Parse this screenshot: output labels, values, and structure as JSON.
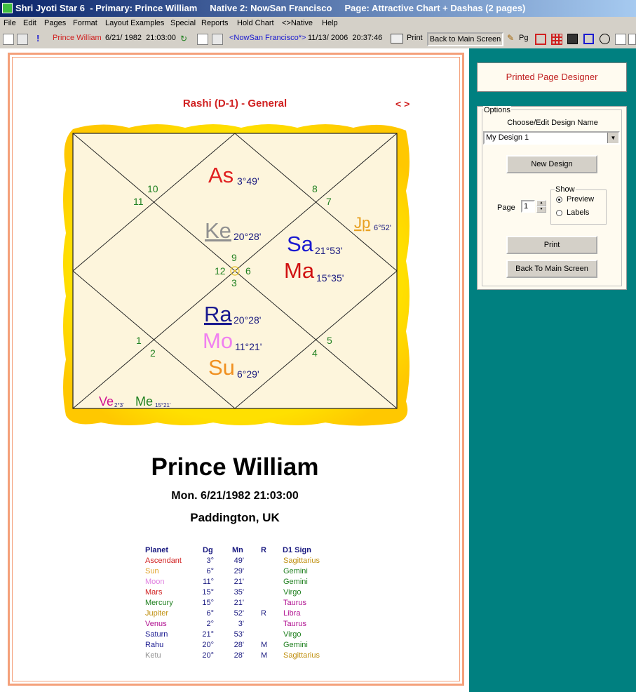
{
  "window": {
    "title": "Shri Jyoti Star 6  - Primary: Prince William     Native 2: NowSan Francisco     Page: Attractive Chart + Dashas (2 pages)"
  },
  "menu": [
    "File",
    "Edit",
    "Pages",
    "Format",
    "Layout Examples",
    "Special",
    "Reports",
    "Hold Chart",
    "<>Native",
    "Help"
  ],
  "toolbar": {
    "primary_name": "Prince William",
    "primary_datetime": "6/21/ 1982  21:03:00",
    "native2_name": "<NowSan Francisco*>",
    "native2_datetime": "11/13/ 2006  20:37:46",
    "print_label": "Print",
    "back_main_label": "Back to Main Screen",
    "pg_label": "Pg"
  },
  "chart": {
    "title": "Rashi (D-1) - General",
    "nav": "< >",
    "houses": {
      "h1": "1",
      "h2": "2",
      "h3": "3",
      "h4": "4",
      "h5": "5",
      "h6": "6",
      "h7": "7",
      "h8": "8",
      "h9": "9",
      "h10": "10",
      "h11": "11",
      "h12": "12"
    },
    "planets": {
      "as": {
        "abbr": "As",
        "deg": "3°49'",
        "color": "#e02020"
      },
      "ke": {
        "abbr": "Ke",
        "deg": "20°28'",
        "color": "#909090"
      },
      "sa": {
        "abbr": "Sa",
        "deg": "21°53'",
        "color": "#1a1ad0"
      },
      "ma": {
        "abbr": "Ma",
        "deg": "15°35'",
        "color": "#d01010"
      },
      "jp": {
        "abbr": "Jp",
        "deg": "6°52'",
        "color": "#e8a020"
      },
      "ra": {
        "abbr": "Ra",
        "deg": "20°28'",
        "color": "#1a1a90"
      },
      "mo": {
        "abbr": "Mo",
        "deg": "11°21'",
        "color": "#f080f0"
      },
      "su": {
        "abbr": "Su",
        "deg": "6°29'",
        "color": "#f09020"
      },
      "ve": {
        "abbr": "Ve",
        "deg": "2°3'",
        "color": "#d01090"
      },
      "me": {
        "abbr": "Me",
        "deg": "15°21'",
        "color": "#208020"
      }
    }
  },
  "person": {
    "name": "Prince William",
    "datetime": "Mon. 6/21/1982  21:03:00",
    "place": "Paddington, UK"
  },
  "table": {
    "headers": [
      "Planet",
      "Dg",
      "Mn",
      "R",
      "D1 Sign"
    ],
    "rows": [
      {
        "planet": "Ascendant",
        "dg": "3°",
        "mn": "49'",
        "r": "",
        "sign": "Sagittarius",
        "pcolor": "#d02020",
        "scolor": "#c09010"
      },
      {
        "planet": "Sun",
        "dg": "6°",
        "mn": "29'",
        "r": "",
        "sign": "Gemini",
        "pcolor": "#e0a020",
        "scolor": "#208020"
      },
      {
        "planet": "Moon",
        "dg": "11°",
        "mn": "21'",
        "r": "",
        "sign": "Gemini",
        "pcolor": "#e080e0",
        "scolor": "#208020"
      },
      {
        "planet": "Mars",
        "dg": "15°",
        "mn": "35'",
        "r": "",
        "sign": "Virgo",
        "pcolor": "#d02020",
        "scolor": "#208020"
      },
      {
        "planet": "Mercury",
        "dg": "15°",
        "mn": "21'",
        "r": "",
        "sign": "Taurus",
        "pcolor": "#208020",
        "scolor": "#b01090"
      },
      {
        "planet": "Jupiter",
        "dg": "6°",
        "mn": "52'",
        "r": "R",
        "sign": "Libra",
        "pcolor": "#c09010",
        "scolor": "#b01090"
      },
      {
        "planet": "Venus",
        "dg": "2°",
        "mn": "3'",
        "r": "",
        "sign": "Taurus",
        "pcolor": "#b01090",
        "scolor": "#b01090"
      },
      {
        "planet": "Saturn",
        "dg": "21°",
        "mn": "53'",
        "r": "",
        "sign": "Virgo",
        "pcolor": "#1a1a90",
        "scolor": "#208020"
      },
      {
        "planet": "Rahu",
        "dg": "20°",
        "mn": "28'",
        "r": "M",
        "sign": "Gemini",
        "pcolor": "#1a1a90",
        "scolor": "#208020"
      },
      {
        "planet": "Ketu",
        "dg": "20°",
        "mn": "28'",
        "r": "M",
        "sign": "Sagittarius",
        "pcolor": "#909090",
        "scolor": "#c09010"
      }
    ]
  },
  "designer": {
    "title": "Printed Page Designer",
    "options_label": "Options",
    "choose_label": "Choose/Edit Design Name",
    "design_value": "My Design 1",
    "new_design_label": "New Design",
    "page_label": "Page",
    "page_value": "1",
    "show_label": "Show",
    "preview_label": "Preview",
    "labels_label": "Labels",
    "print_label": "Print",
    "back_label": "Back To Main Screen"
  }
}
